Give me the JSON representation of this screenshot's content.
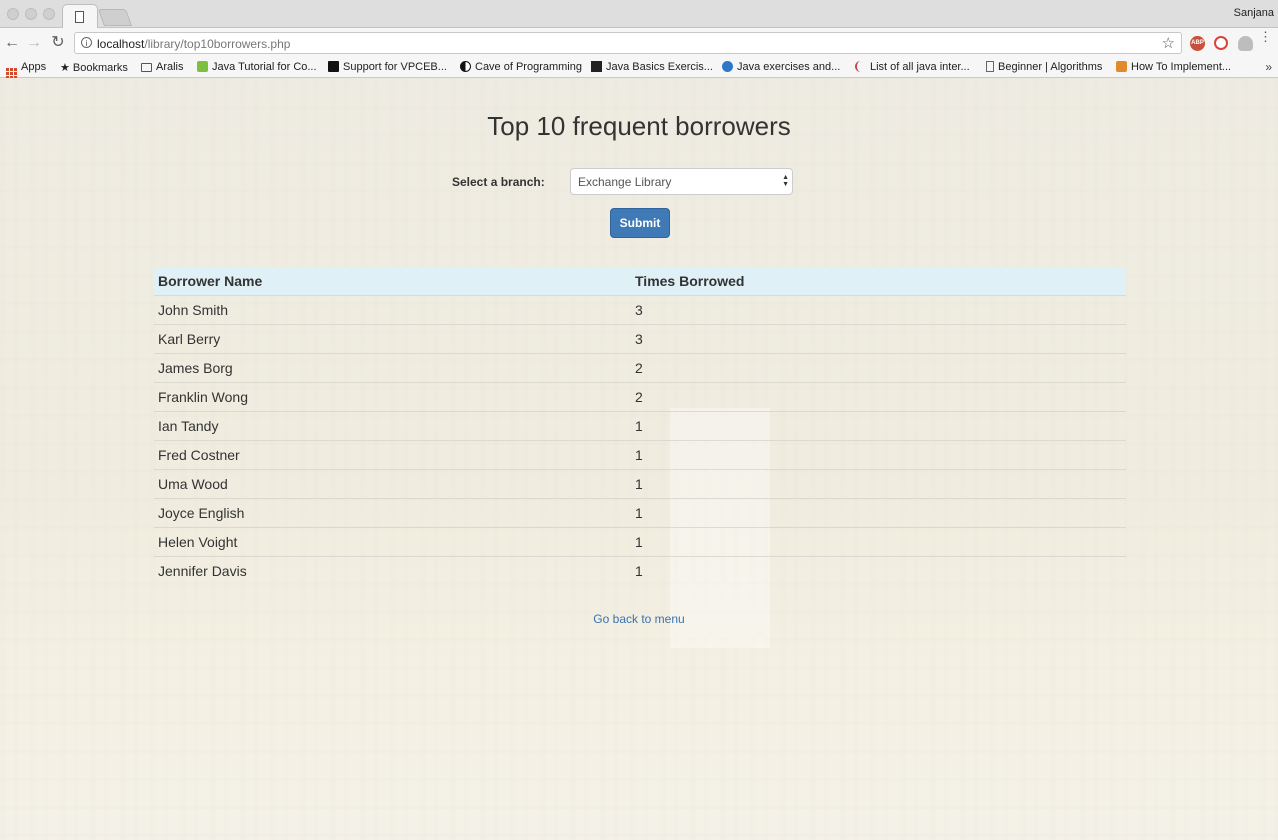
{
  "browser": {
    "profile_name": "Sanjana",
    "url_host": "localhost",
    "url_path": "/library/top10borrowers.php",
    "bookmarks": [
      {
        "label": "Apps"
      },
      {
        "label": "Bookmarks"
      },
      {
        "label": "Aralis"
      },
      {
        "label": "Java Tutorial for Co..."
      },
      {
        "label": "Support for VPCEB..."
      },
      {
        "label": "Cave of Programming"
      },
      {
        "label": "Java Basics Exercis..."
      },
      {
        "label": "Java exercises and..."
      },
      {
        "label": "List of all java inter..."
      },
      {
        "label": "Beginner | Algorithms"
      },
      {
        "label": "How To Implement..."
      }
    ],
    "extensions": [
      "ABP",
      "opera-icon",
      "cloud-icon"
    ]
  },
  "page": {
    "title": "Top 10 frequent borrowers",
    "branch_label": "Select a branch:",
    "branch_selected": "Exchange Library",
    "submit_label": "Submit",
    "back_link": "Go back to menu"
  },
  "table": {
    "headers": [
      "Borrower Name",
      "Times Borrowed"
    ],
    "rows": [
      [
        "John Smith",
        "3"
      ],
      [
        "Karl Berry",
        "3"
      ],
      [
        "James Borg",
        "2"
      ],
      [
        "Franklin Wong",
        "2"
      ],
      [
        "Ian Tandy",
        "1"
      ],
      [
        "Fred Costner",
        "1"
      ],
      [
        "Uma Wood",
        "1"
      ],
      [
        "Joyce English",
        "1"
      ],
      [
        "Helen Voight",
        "1"
      ],
      [
        "Jennifer Davis",
        "1"
      ]
    ]
  }
}
